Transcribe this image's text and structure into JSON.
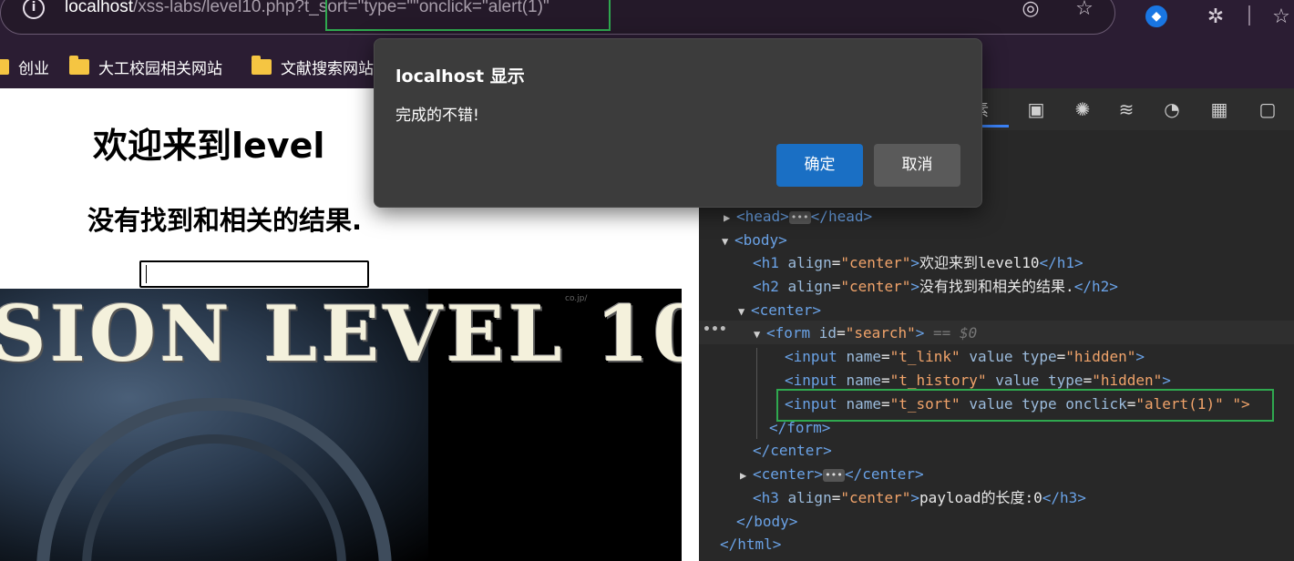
{
  "browser": {
    "url_host": "localhost",
    "url_rest": "/xss-labs/level10.php?t_sort=\"type=\"\"onclick=\"alert(1)\"",
    "icons": [
      "info-icon",
      "edge-refresh-icon",
      "favorite-star-icon",
      "extension-badge-icon",
      "extensions-puzzle-icon",
      "favorites-icon"
    ]
  },
  "bookmarks": [
    {
      "label": "创业"
    },
    {
      "label": "大工校园相关网站"
    },
    {
      "label": "文献搜索网站"
    }
  ],
  "page": {
    "h1": "欢迎来到level",
    "h2": "没有找到和相关的结果.",
    "search_value": "",
    "banner_title": "SION LEVEL 10",
    "banner_watermark": "co.jp/"
  },
  "devtools": {
    "tab_partial": "素",
    "lines": [
      {
        "indent": 0,
        "tri": "▶",
        "html": "head"
      },
      {
        "indent": 0,
        "tri": "▼",
        "html": "body"
      },
      {
        "indent": 1,
        "tri": "",
        "html": "h1"
      },
      {
        "indent": 1,
        "tri": "",
        "html": "h2"
      },
      {
        "indent": 1,
        "tri": "▼",
        "html": "center"
      },
      {
        "indent": 2,
        "tri": "▼",
        "html": "form"
      },
      {
        "indent": 3,
        "tri": "",
        "html": "input_link"
      },
      {
        "indent": 3,
        "tri": "",
        "html": "input_history"
      },
      {
        "indent": 3,
        "tri": "",
        "html": "input_sort"
      },
      {
        "indent": 2,
        "tri": "",
        "html": "form_close"
      },
      {
        "indent": 1,
        "tri": "",
        "html": "center_close"
      },
      {
        "indent": 1,
        "tri": "▶",
        "html": "center2"
      },
      {
        "indent": 1,
        "tri": "",
        "html": "h3"
      },
      {
        "indent": 0,
        "tri": "",
        "html": "body_close"
      },
      {
        "indent": 0,
        "tri": "",
        "html": "html_close"
      }
    ],
    "code": {
      "head_open": "<head>",
      "head_close": "</head>",
      "body_open": "<body>",
      "h1_open": "<h1 ",
      "h1_attr": "align",
      "h1_val": "\"center\"",
      "h1_text": "欢迎来到level10",
      "h1_close": "</h1>",
      "h2_open": "<h2 ",
      "h2_attr": "align",
      "h2_val": "\"center\"",
      "h2_text": "没有找到和相关的结果.",
      "h2_close": "</h2>",
      "center_open": "<center>",
      "form_open": "<form ",
      "form_attr": "id",
      "form_val": "\"search\"",
      "form_end": ">",
      "form_sel": "== $0",
      "input_open": "<input ",
      "name_attr": "name",
      "link_val": "\"t_link\"",
      "history_val": "\"t_history\"",
      "sort_val": "\"t_sort\"",
      "value_attr": "value",
      "type_attr": "type",
      "hidden_val": "\"hidden\"",
      "onclick_attr": "onclick",
      "onclick_val": "\"alert(1)\"",
      "sort_tail": "\">",
      "gt": ">",
      "form_close": "</form>",
      "center_close": "</center>",
      "h3_open": "<h3 ",
      "h3_attr": "align",
      "h3_val": "\"center\"",
      "h3_text": "payload的长度:0",
      "h3_close": "</h3>",
      "body_close": "</body>",
      "html_close": "</html>",
      "eq": "="
    }
  },
  "dialog": {
    "title": "localhost 显示",
    "message": "完成的不错!",
    "ok_label": "确定",
    "cancel_label": "取消"
  },
  "colors": {
    "accent": "#1a6fc4",
    "highlight": "#2fa84f",
    "tag": "#6aa2e6",
    "attr_value": "#f0a36a"
  }
}
